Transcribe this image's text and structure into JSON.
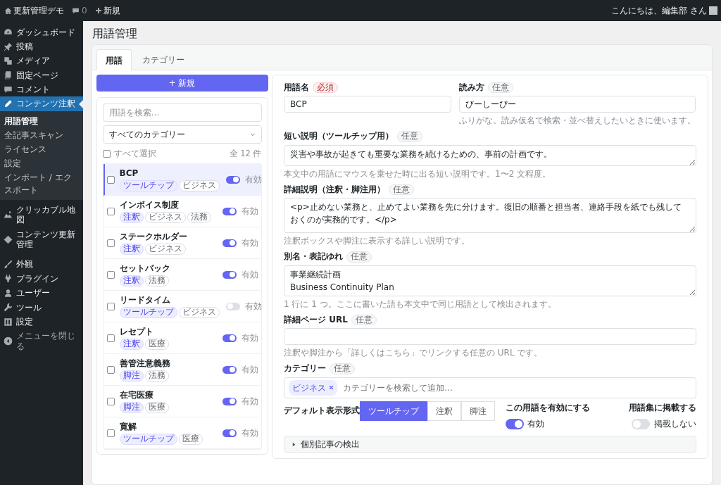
{
  "admin_bar": {
    "site_name": "更新管理デモ",
    "comments_count": "0",
    "new_label": "新規",
    "greeting": "こんにちは、編集部 さん"
  },
  "sidebar": {
    "items": [
      {
        "label": "ダッシュボード",
        "selected": false
      },
      {
        "label": "投稿",
        "selected": false
      },
      {
        "label": "メディア",
        "selected": false
      },
      {
        "label": "固定ページ",
        "selected": false
      },
      {
        "label": "コメント",
        "selected": false
      },
      {
        "label": "コンテンツ注釈",
        "selected": true,
        "children": [
          {
            "label": "用語管理",
            "selected": true
          },
          {
            "label": "全記事スキャン",
            "selected": false
          },
          {
            "label": "ライセンス",
            "selected": false
          },
          {
            "label": "設定",
            "selected": false
          },
          {
            "label": "インポート / エクスポート",
            "selected": false
          }
        ]
      },
      {
        "label": "クリッカブル地図",
        "selected": false
      },
      {
        "label": "コンテンツ更新管理",
        "selected": false
      },
      {
        "label": "外観",
        "selected": false
      },
      {
        "label": "プラグイン",
        "selected": false
      },
      {
        "label": "ユーザー",
        "selected": false
      },
      {
        "label": "ツール",
        "selected": false
      },
      {
        "label": "設定",
        "selected": false
      }
    ],
    "close_label": "メニューを閉じる"
  },
  "page_title": "用語管理",
  "tabs": [
    {
      "label": "用語",
      "selected": true
    },
    {
      "label": "カテゴリー",
      "selected": false
    }
  ],
  "term_list": {
    "new_button": "+ 新規",
    "search_placeholder": "用語を検索…",
    "category_filter": "すべてのカテゴリー",
    "select_all": {
      "label": "すべて選択",
      "checked": false
    },
    "count": "全 12 件",
    "terms": [
      {
        "name": "BCP",
        "selected": true,
        "checked": false,
        "enabled": true,
        "status": "有効",
        "tags": [
          {
            "label": "ツールチップ",
            "kind": "type"
          },
          {
            "label": "ビジネス",
            "kind": "category"
          }
        ]
      },
      {
        "name": "インボイス制度",
        "selected": false,
        "checked": false,
        "enabled": true,
        "status": "有効",
        "tags": [
          {
            "label": "注釈",
            "kind": "type"
          },
          {
            "label": "ビジネス",
            "kind": "category"
          },
          {
            "label": "法務",
            "kind": "category"
          }
        ]
      },
      {
        "name": "ステークホルダー",
        "selected": false,
        "checked": false,
        "enabled": true,
        "status": "有効",
        "tags": [
          {
            "label": "注釈",
            "kind": "type"
          },
          {
            "label": "ビジネス",
            "kind": "category"
          }
        ]
      },
      {
        "name": "セットバック",
        "selected": false,
        "checked": false,
        "enabled": true,
        "status": "有効",
        "tags": [
          {
            "label": "注釈",
            "kind": "type"
          },
          {
            "label": "法務",
            "kind": "category"
          }
        ]
      },
      {
        "name": "リードタイム",
        "selected": false,
        "checked": false,
        "enabled": false,
        "status": "有効",
        "tags": [
          {
            "label": "ツールチップ",
            "kind": "type"
          },
          {
            "label": "ビジネス",
            "kind": "category"
          }
        ]
      },
      {
        "name": "レセプト",
        "selected": false,
        "checked": false,
        "enabled": true,
        "status": "有効",
        "tags": [
          {
            "label": "注釈",
            "kind": "type"
          },
          {
            "label": "医療",
            "kind": "category"
          }
        ]
      },
      {
        "name": "善管注意義務",
        "selected": false,
        "checked": false,
        "enabled": true,
        "status": "有効",
        "tags": [
          {
            "label": "脚注",
            "kind": "type"
          },
          {
            "label": "法務",
            "kind": "category"
          }
        ]
      },
      {
        "name": "在宅医療",
        "selected": false,
        "checked": false,
        "enabled": true,
        "status": "有効",
        "tags": [
          {
            "label": "脚注",
            "kind": "type"
          },
          {
            "label": "医療",
            "kind": "category"
          }
        ]
      },
      {
        "name": "寛解",
        "selected": false,
        "checked": false,
        "enabled": true,
        "status": "有効",
        "tags": [
          {
            "label": "ツールチップ",
            "kind": "type"
          },
          {
            "label": "医療",
            "kind": "category"
          }
        ]
      }
    ]
  },
  "form": {
    "name": {
      "label": "用語名",
      "badge": {
        "label": "必須",
        "kind": "required"
      },
      "value": "BCP"
    },
    "reading": {
      "label": "読み方",
      "badge": {
        "label": "任意",
        "kind": "optional"
      },
      "value": "びーしーぴー",
      "help": "ふりがな。読み仮名で検索・並べ替えしたいときに使います。"
    },
    "short_description": {
      "label": "短い説明（ツールチップ用）",
      "badge": {
        "label": "任意",
        "kind": "optional"
      },
      "value": "災害や事故が起きても重要な業務を続けるための、事前の計画です。",
      "help": "本文中の用語にマウスを乗せた時に出る短い説明です。1〜2 文程度。"
    },
    "detail_description": {
      "label": "詳細説明（注釈・脚注用）",
      "badge": {
        "label": "任意",
        "kind": "optional"
      },
      "value": "<p>止めない業務と、止めてよい業務を先に分けます。復旧の順番と担当者、連絡手段を紙でも残しておくのが実務的です。</p>",
      "help": "注釈ボックスや脚注に表示する詳しい説明です。"
    },
    "aliases": {
      "label": "別名・表記ゆれ",
      "badge": {
        "label": "任意",
        "kind": "optional"
      },
      "value": "事業継続計画\nBusiness Continuity Plan",
      "help": "1 行に 1 つ。ここに書いた語も本文中で同じ用語として検出されます。"
    },
    "url": {
      "label": "詳細ページ URL",
      "badge": {
        "label": "任意",
        "kind": "optional"
      },
      "help": "注釈や脚注から「詳しくはこちら」でリンクする任意の URL です。"
    },
    "category": {
      "label": "カテゴリー",
      "badge": {
        "label": "任意",
        "kind": "optional"
      },
      "tags": [
        {
          "label": "ビジネス"
        }
      ],
      "placeholder": "カテゴリーを検索して追加…"
    },
    "display_format": {
      "label": "デフォルト表示形式",
      "options": [
        {
          "label": "ツールチップ",
          "selected": true
        },
        {
          "label": "注釈",
          "selected": false
        },
        {
          "label": "脚注",
          "selected": false
        }
      ]
    },
    "enabled": {
      "label": "この用語を有効にする",
      "on": true,
      "state_label": "有効"
    },
    "glossary": {
      "label": "用語集に掲載する",
      "on": false,
      "state_label": "掲載しない"
    },
    "section": {
      "label": "個別記事の検出",
      "expanded": false
    }
  }
}
